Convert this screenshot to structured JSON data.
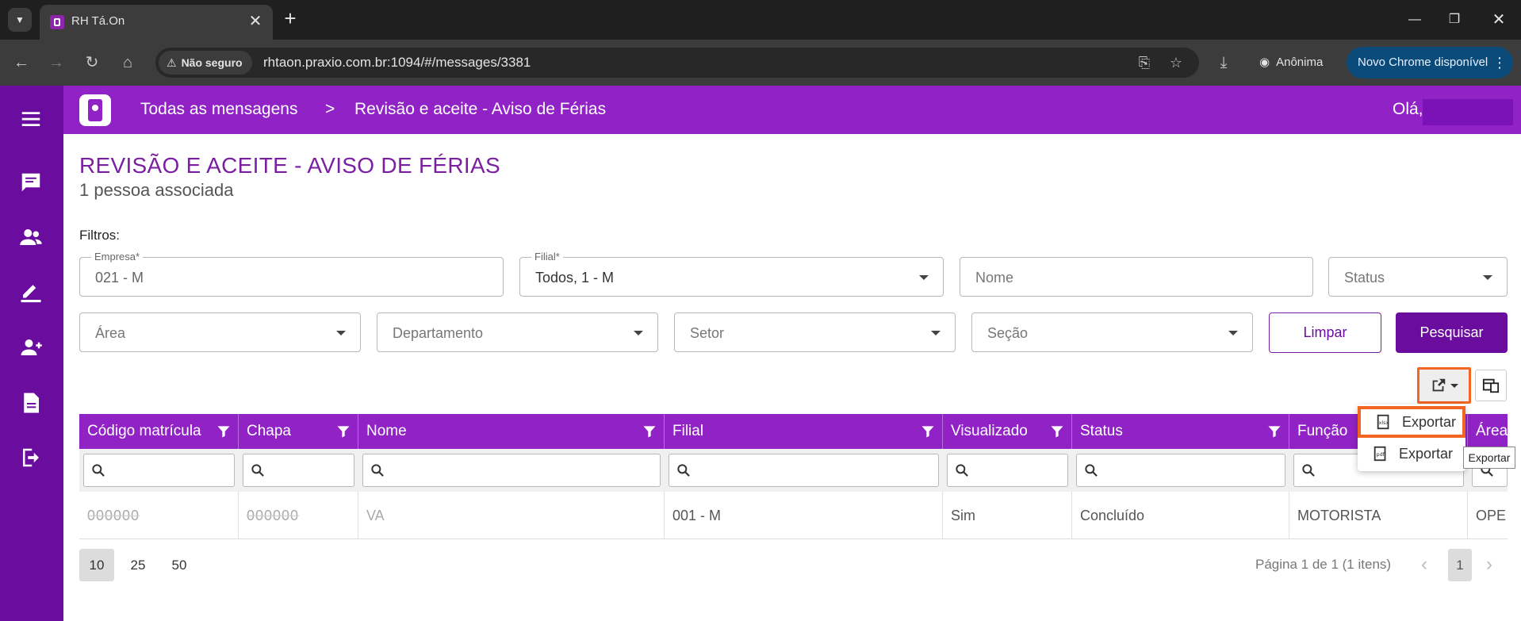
{
  "browser": {
    "tab_title": "RH Tá.On",
    "security_label": "Não seguro",
    "url": "rhtaon.praxio.com.br:1094/#/messages/3381",
    "incognito_label": "Anônima",
    "update_label": "Novo Chrome disponível"
  },
  "header": {
    "breadcrumb_root": "Todas as mensagens",
    "breadcrumb_separator": ">",
    "breadcrumb_current": "Revisão e aceite - Aviso de Férias",
    "greeting": "Olá,"
  },
  "page": {
    "title": "REVISÃO E ACEITE - AVISO DE FÉRIAS",
    "subtitle": "1 pessoa associada",
    "filters_label": "Filtros:"
  },
  "filters": {
    "empresa": {
      "label": "Empresa*",
      "value": "021 - M"
    },
    "filial": {
      "label": "Filial*",
      "value": "Todos, 1 - M"
    },
    "nome": {
      "placeholder": "Nome"
    },
    "status": {
      "placeholder": "Status"
    },
    "area": {
      "placeholder": "Área"
    },
    "departamento": {
      "placeholder": "Departamento"
    },
    "setor": {
      "placeholder": "Setor"
    },
    "secao": {
      "placeholder": "Seção"
    },
    "clear_label": "Limpar",
    "search_label": "Pesquisar"
  },
  "grid": {
    "columns": [
      "Código matrícula",
      "Chapa",
      "Nome",
      "Filial",
      "Visualizado",
      "Status",
      "Função",
      "Área"
    ],
    "rows": [
      [
        "000000",
        "000000",
        "VA",
        "001 - M",
        "Sim",
        "Concluído",
        "MOTORISTA",
        "OPE"
      ]
    ]
  },
  "pager": {
    "sizes": [
      "10",
      "25",
      "50"
    ],
    "active_size": "10",
    "info": "Página 1 de 1 (1 itens)",
    "current_page": "1"
  },
  "export_menu": {
    "items": [
      "Exportar",
      "Exportar"
    ],
    "tooltip": "Exportar"
  },
  "colors": {
    "header_purple": "#9122c6",
    "sidebar_purple": "#6a0d9e",
    "title_purple": "#7b1fa2",
    "highlight_orange": "#f26522"
  }
}
